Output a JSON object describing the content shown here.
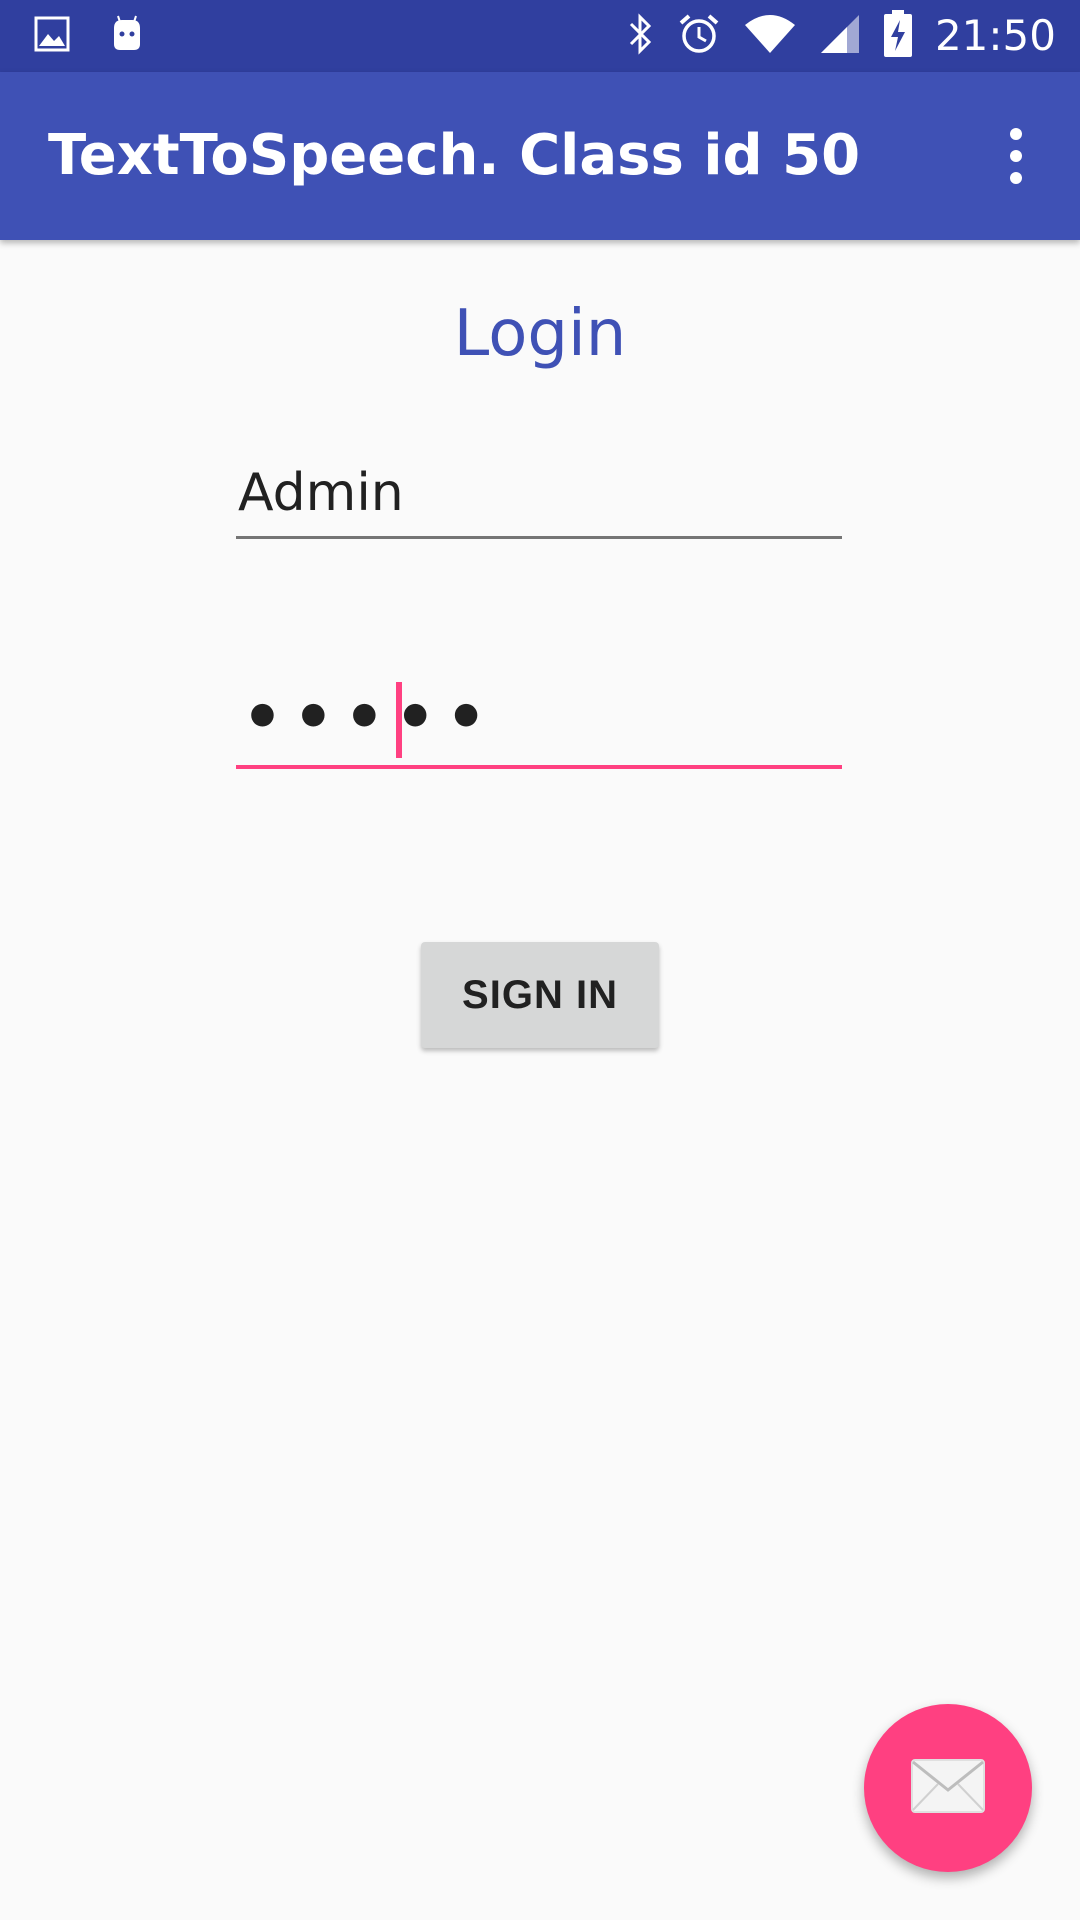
{
  "status_bar": {
    "time": "21:50",
    "icons": [
      "image-icon",
      "android-icon",
      "bluetooth-icon",
      "alarm-icon",
      "wifi-icon",
      "signal-icon",
      "battery-charging-icon"
    ]
  },
  "app_bar": {
    "title": "TextToSpeech. Class id 50",
    "overflow_icon": "more-vert-icon"
  },
  "login": {
    "heading": "Login",
    "username_value": "Admin",
    "password_masked": "•••••",
    "sign_in_label": "SIGN IN"
  },
  "fab": {
    "icon": "mail-icon"
  },
  "colors": {
    "status_bar": "#303f9f",
    "primary": "#3f51b5",
    "accent": "#ff4081",
    "background": "#fafafa",
    "button": "#d6d7d7"
  }
}
